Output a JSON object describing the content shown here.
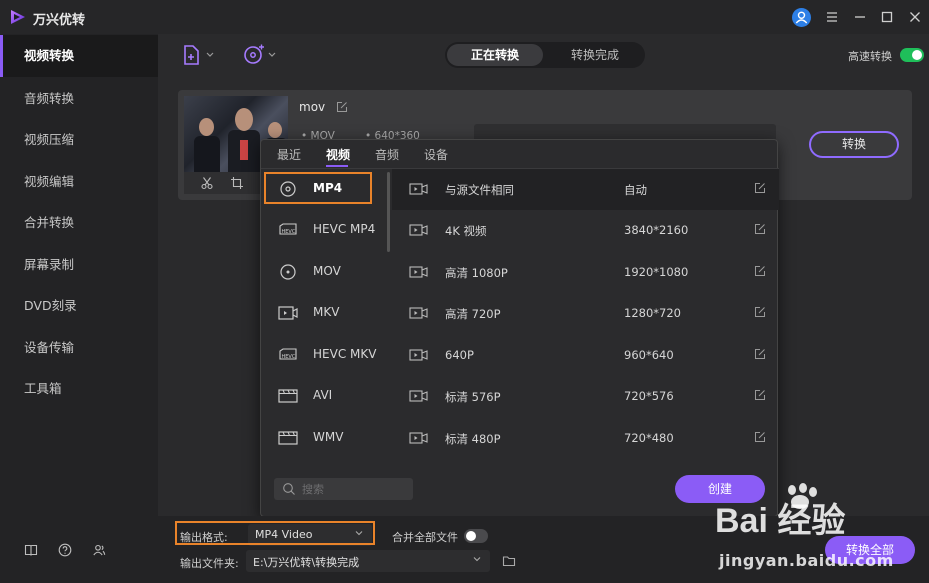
{
  "app": {
    "title": "万兴优转"
  },
  "sidebar": {
    "items": [
      {
        "label": "视频转换",
        "active": true
      },
      {
        "label": "音频转换"
      },
      {
        "label": "视频压缩"
      },
      {
        "label": "视频编辑"
      },
      {
        "label": "合并转换"
      },
      {
        "label": "屏幕录制"
      },
      {
        "label": "DVD刻录"
      },
      {
        "label": "设备传输"
      },
      {
        "label": "工具箱"
      }
    ],
    "footer_icons": [
      "book-icon",
      "help-icon",
      "users-icon"
    ]
  },
  "toolbar": {
    "tabs": [
      {
        "label": "正在转换",
        "active": true
      },
      {
        "label": "转换完成"
      }
    ],
    "high_speed_label": "高速转换",
    "high_speed_on": true
  },
  "file": {
    "name": "mov",
    "meta_format": "MOV",
    "meta_resolution": "640*360",
    "convert_label": "转换"
  },
  "popover": {
    "tabs": [
      "最近",
      "视频",
      "音频",
      "设备"
    ],
    "active_tab": "视频",
    "formats": [
      "MP4",
      "HEVC MP4",
      "MOV",
      "MKV",
      "HEVC MKV",
      "AVI",
      "WMV"
    ],
    "selected_format": "MP4",
    "resolutions": [
      {
        "name": "与源文件相同",
        "value": "自动"
      },
      {
        "name": "4K 视频",
        "value": "3840*2160"
      },
      {
        "name": "高清 1080P",
        "value": "1920*1080"
      },
      {
        "name": "高清 720P",
        "value": "1280*720"
      },
      {
        "name": "640P",
        "value": "960*640"
      },
      {
        "name": "标清 576P",
        "value": "720*576"
      },
      {
        "name": "标清 480P",
        "value": "720*480"
      }
    ],
    "search_placeholder": "搜索",
    "create_label": "创建"
  },
  "bottom": {
    "output_format_label": "输出格式:",
    "output_format_value": "MP4 Video",
    "merge_label": "合并全部文件",
    "merge_on": false,
    "output_folder_label": "输出文件夹:",
    "output_folder_value": "E:\\万兴优转\\转换完成",
    "convert_all_label": "转换全部"
  },
  "watermark": {
    "brand": "Bai 经验",
    "url": "jingyan.baidu.com"
  },
  "colors": {
    "accent": "#8b5cf6",
    "highlight": "#e9832a",
    "toggle_on": "#1fbf5a"
  }
}
